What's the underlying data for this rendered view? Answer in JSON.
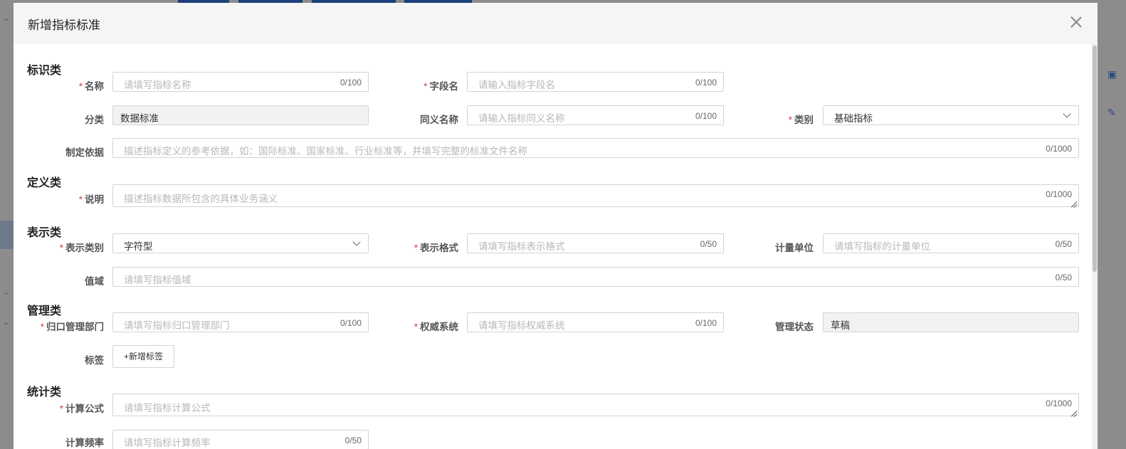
{
  "dialog": {
    "title": "新增指标标准"
  },
  "sections": {
    "identify": "标识类",
    "define": "定义类",
    "represent": "表示类",
    "manage": "管理类",
    "stats": "统计类"
  },
  "fields": {
    "name": {
      "label": "名称",
      "placeholder": "请填写指标名称",
      "count": "0/100",
      "required": true
    },
    "field_name": {
      "label": "字段名",
      "placeholder": "请输入指标字段名",
      "count": "0/100",
      "required": true
    },
    "category": {
      "label": "分类",
      "value": "数据标准"
    },
    "synonym": {
      "label": "同义名称",
      "placeholder": "请输入指标同义名称",
      "count": "0/100"
    },
    "type": {
      "label": "类别",
      "value": "基础指标",
      "required": true
    },
    "basis": {
      "label": "制定依据",
      "placeholder": "描述指标定义的参考依据，如：国际标准、国家标准、行业标准等，并填写完整的标准文件名称",
      "count": "0/1000"
    },
    "description": {
      "label": "说明",
      "placeholder": "描述指标数据所包含的具体业务涵义",
      "count": "0/1000",
      "required": true
    },
    "repr_type": {
      "label": "表示类别",
      "value": "字符型",
      "required": true
    },
    "repr_format": {
      "label": "表示格式",
      "placeholder": "请填写指标表示格式",
      "count": "0/50",
      "required": true
    },
    "unit": {
      "label": "计量单位",
      "placeholder": "请填写指标的计量单位",
      "count": "0/50"
    },
    "domain": {
      "label": "值域",
      "placeholder": "请填写指标值域",
      "count": "0/50"
    },
    "dept": {
      "label": "归口管理部门",
      "placeholder": "请填写指标归口管理部门",
      "count": "0/100",
      "required": true
    },
    "authority": {
      "label": "权威系统",
      "placeholder": "请填写指标权威系统",
      "count": "0/100",
      "required": true
    },
    "mgmt_status": {
      "label": "管理状态",
      "value": "草稿"
    },
    "tags": {
      "label": "标签",
      "button": "+新增标签"
    },
    "formula": {
      "label": "计算公式",
      "placeholder": "请填写指标计算公式",
      "count": "0/1000",
      "required": true
    },
    "frequency": {
      "label": "计算频率",
      "placeholder": "请填写指标计算频率",
      "count": "0/50"
    }
  },
  "required_mark": "*",
  "colors": {
    "required": "#e03b3b",
    "header_bg": "#f5f5f5",
    "overlay": "#8c8c8c"
  }
}
